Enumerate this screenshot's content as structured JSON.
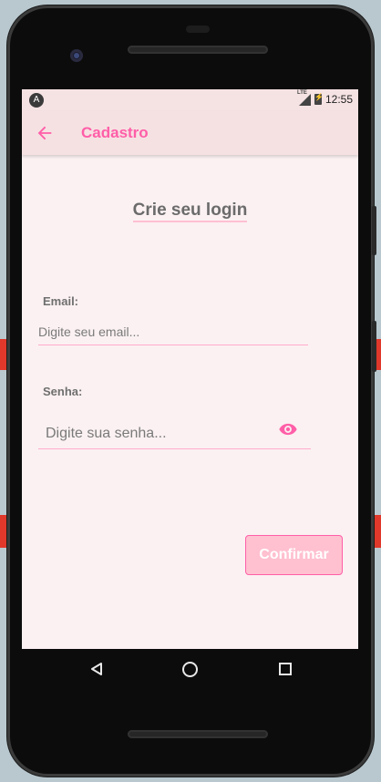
{
  "status_bar": {
    "network": "LTE",
    "time": "12:55"
  },
  "app_bar": {
    "title": "Cadastro"
  },
  "page": {
    "title": "Crie seu login"
  },
  "form": {
    "email": {
      "label": "Email:",
      "placeholder": "Digite seu email...",
      "value": ""
    },
    "password": {
      "label": "Senha:",
      "placeholder": "Digite sua senha...",
      "value": ""
    }
  },
  "actions": {
    "confirm_label": "Confirmar"
  },
  "colors": {
    "accent": "#ff5ea8",
    "button_bg": "#ffc0d0",
    "screen_bg": "#fbf1f2",
    "appbar_bg": "#f6e1e2"
  },
  "icons": {
    "back": "arrow-left-icon",
    "visibility": "eye-icon"
  }
}
